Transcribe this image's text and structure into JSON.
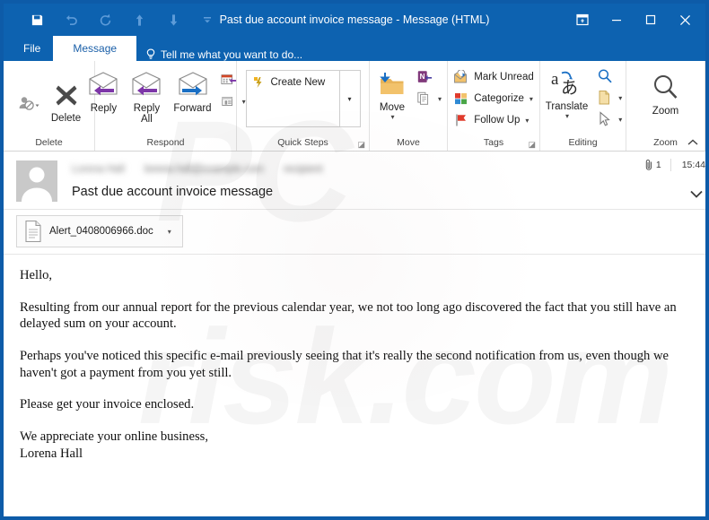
{
  "window": {
    "title": "Past due account invoice message - Message (HTML)",
    "accent_color": "#0d62b0",
    "border_color": "#0d5ba8"
  },
  "quick_access_toolbar": {
    "items": [
      {
        "name": "save",
        "label": "Save",
        "icon": "floppy-disk-icon"
      },
      {
        "name": "undo",
        "label": "Undo",
        "icon": "undo-arrow-icon"
      },
      {
        "name": "redo",
        "label": "Redo",
        "icon": "redo-arrow-icon"
      },
      {
        "name": "previous-item",
        "label": "Previous Item",
        "icon": "arrow-up-icon"
      },
      {
        "name": "next-item",
        "label": "Next Item",
        "icon": "arrow-down-icon"
      },
      {
        "name": "customize",
        "label": "Customize Quick Access Toolbar",
        "icon": "chevron-down-icon"
      }
    ]
  },
  "window_controls": [
    {
      "name": "ribbon-display-options",
      "label": "Ribbon Display Options",
      "icon": "ribbon-options-icon"
    },
    {
      "name": "minimize",
      "label": "Minimize",
      "icon": "minimize-icon"
    },
    {
      "name": "maximize",
      "label": "Maximize",
      "icon": "maximize-icon"
    },
    {
      "name": "close",
      "label": "Close",
      "icon": "close-icon"
    }
  ],
  "tabs": {
    "file_label": "File",
    "message_label": "Message",
    "tell_me_placeholder": "Tell me what you want to do..."
  },
  "ribbon": {
    "groups": [
      {
        "name": "delete",
        "label": "Delete",
        "ignore_label": "",
        "delete_label": "Delete"
      },
      {
        "name": "respond",
        "label": "Respond",
        "reply_label": "Reply",
        "reply_all_label": "Reply\nAll",
        "reply_all_line1": "Reply",
        "reply_all_line2": "All",
        "forward_label": "Forward"
      },
      {
        "name": "quick-steps",
        "label": "Quick Steps",
        "create_new_label": "Create New"
      },
      {
        "name": "move",
        "label": "Move",
        "move_label": "Move"
      },
      {
        "name": "tags",
        "label": "Tags",
        "mark_unread_label": "Mark Unread",
        "categorize_label": "Categorize",
        "follow_up_label": "Follow Up"
      },
      {
        "name": "editing",
        "label": "Editing",
        "translate_label": "Translate"
      },
      {
        "name": "zoom",
        "label": "Zoom",
        "zoom_label": "Zoom"
      }
    ]
  },
  "message": {
    "sender_name_redacted": "Lorena Hall",
    "sender_email_redacted": "lorena.hall@example.com",
    "recipient_redacted": "recipient",
    "subject": "Past due account invoice message",
    "attachment_count": "1",
    "time": "15:44",
    "attachment": {
      "filename": "Alert_0408006966.doc"
    },
    "body": {
      "paragraphs": [
        "Hello,",
        "Resulting from our annual report for the previous calendar year, we not too long ago discovered the fact that you still have an delayed sum on your account.",
        "Perhaps you've noticed this specific e-mail previously seeing that it's really the second notification from us, even though we haven't got a payment from you yet still.",
        "Please get your invoice enclosed.",
        "We appreciate your online business,"
      ],
      "signature": "Lorena Hall"
    }
  },
  "watermark": {
    "text_a": "PC",
    "text_b": "risk.com"
  }
}
